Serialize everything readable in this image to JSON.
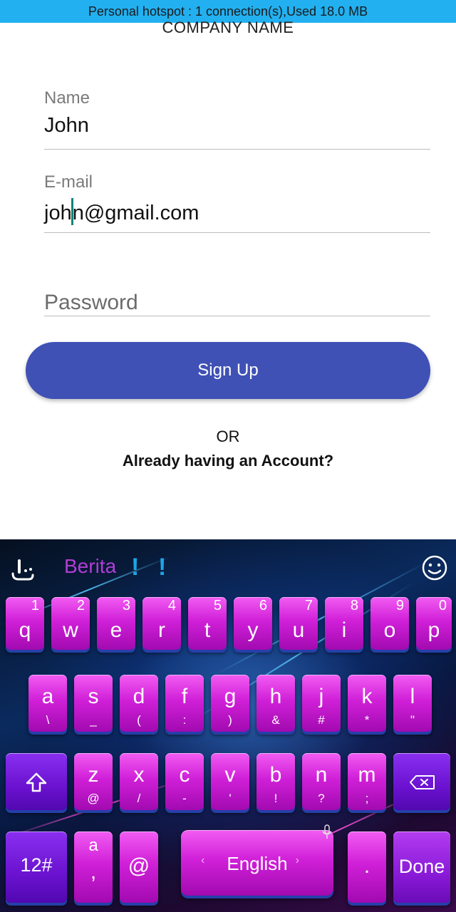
{
  "status_bar": {
    "text": "Personal hotspot : 1 connection(s),Used  18.0 MB"
  },
  "header": {
    "company_name": "COMPANY NAME"
  },
  "form": {
    "name": {
      "label": "Name",
      "value": "John"
    },
    "email": {
      "label": "E-mail",
      "value_before_cursor": "joh",
      "value_after_cursor": "n@gmail.com"
    },
    "password": {
      "placeholder": "Password"
    },
    "signup_button": "Sign Up",
    "or_text": "OR",
    "login_link": "Already having an Account?"
  },
  "keyboard": {
    "suggestion": "Berita",
    "excl1": "!",
    "excl2": "!",
    "emoji_icon": "smiley-icon",
    "row1": [
      {
        "key": "q",
        "num": "1"
      },
      {
        "key": "w",
        "num": "2"
      },
      {
        "key": "e",
        "num": "3"
      },
      {
        "key": "r",
        "num": "4"
      },
      {
        "key": "t",
        "num": "5"
      },
      {
        "key": "y",
        "num": "6"
      },
      {
        "key": "u",
        "num": "7"
      },
      {
        "key": "i",
        "num": "8"
      },
      {
        "key": "o",
        "num": "9"
      },
      {
        "key": "p",
        "num": "0"
      }
    ],
    "row2": [
      {
        "key": "a",
        "sub": "\\"
      },
      {
        "key": "s",
        "sub": "_"
      },
      {
        "key": "d",
        "sub": "("
      },
      {
        "key": "f",
        "sub": ":"
      },
      {
        "key": "g",
        "sub": ")"
      },
      {
        "key": "h",
        "sub": "&"
      },
      {
        "key": "j",
        "sub": "#"
      },
      {
        "key": "k",
        "sub": "*"
      },
      {
        "key": "l",
        "sub": "\""
      }
    ],
    "row3": [
      {
        "key": "z",
        "sub": "@"
      },
      {
        "key": "x",
        "sub": "/"
      },
      {
        "key": "c",
        "sub": "-"
      },
      {
        "key": "v",
        "sub": "'"
      },
      {
        "key": "b",
        "sub": "!"
      },
      {
        "key": "n",
        "sub": "?"
      },
      {
        "key": "m",
        "sub": ";"
      }
    ],
    "shift_icon": "shift-arrow-icon",
    "backspace_icon": "backspace-icon",
    "symbols_key": "12#",
    "comma_key": {
      "top": "a",
      "main": ","
    },
    "at_key": "@",
    "space_key": "English",
    "period_key": ".",
    "done_key": "Done"
  }
}
